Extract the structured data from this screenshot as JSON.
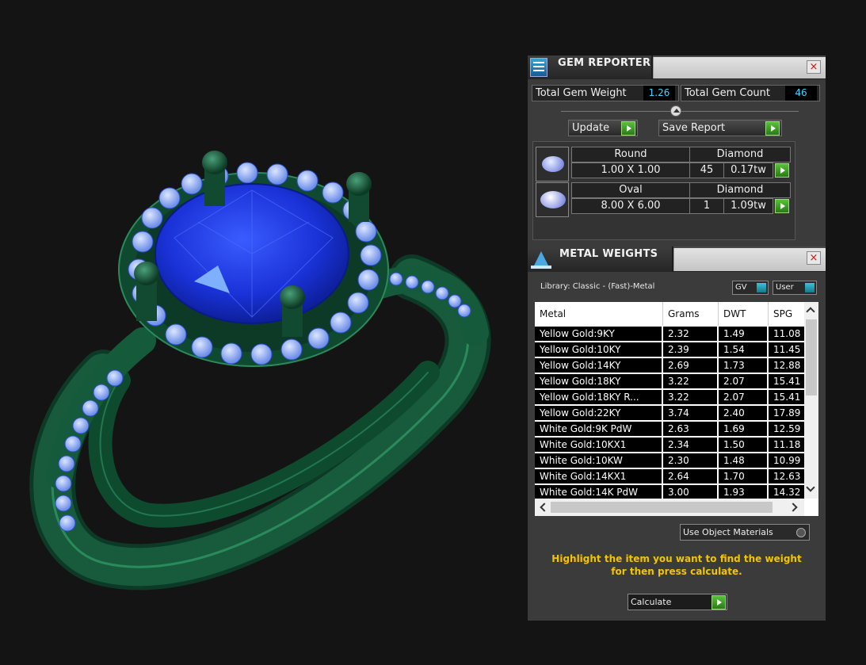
{
  "gem_reporter": {
    "title": "GEM REPORTER",
    "close": "×",
    "total_weight_label": "Total Gem Weight",
    "total_weight_value": "1.26",
    "total_count_label": "Total Gem Count",
    "total_count_value": "46",
    "update_label": "Update",
    "save_report_label": "Save Report",
    "gems": [
      {
        "shape": "Round",
        "material": "Diamond",
        "size": "1.00 X 1.00",
        "count": "45",
        "weight": "0.17tw"
      },
      {
        "shape": "Oval",
        "material": "Diamond",
        "size": "8.00 X 6.00",
        "count": "1",
        "weight": "1.09tw"
      }
    ]
  },
  "metal_weights": {
    "title": "METAL WEIGHTS",
    "close": "×",
    "library_label": "Library: Classic - (Fast)-Metal",
    "gv_label": "GV",
    "user_label": "User",
    "columns": [
      "Metal",
      "Grams",
      "DWT",
      "SPG"
    ],
    "rows": [
      [
        "Yellow Gold:9KY",
        "2.32",
        "1.49",
        "11.08"
      ],
      [
        "Yellow Gold:10KY",
        "2.39",
        "1.54",
        "11.45"
      ],
      [
        "Yellow Gold:14KY",
        "2.69",
        "1.73",
        "12.88"
      ],
      [
        "Yellow Gold:18KY",
        "3.22",
        "2.07",
        "15.41"
      ],
      [
        "Yellow Gold:18KY R...",
        "3.22",
        "2.07",
        "15.41"
      ],
      [
        "Yellow Gold:22KY",
        "3.74",
        "2.40",
        "17.89"
      ],
      [
        "White Gold:9K PdW",
        "2.63",
        "1.69",
        "12.59"
      ],
      [
        "White Gold:10KX1",
        "2.34",
        "1.50",
        "11.18"
      ],
      [
        "White Gold:10KW",
        "2.30",
        "1.48",
        "10.99"
      ],
      [
        "White Gold:14KX1",
        "2.64",
        "1.70",
        "12.63"
      ],
      [
        "White Gold:14K PdW",
        "3.00",
        "1.93",
        "14.32"
      ]
    ],
    "use_object_materials_label": "Use Object Materials",
    "hint": "Highlight the item you want to find the weight for then press calculate.",
    "calculate_label": "Calculate"
  }
}
